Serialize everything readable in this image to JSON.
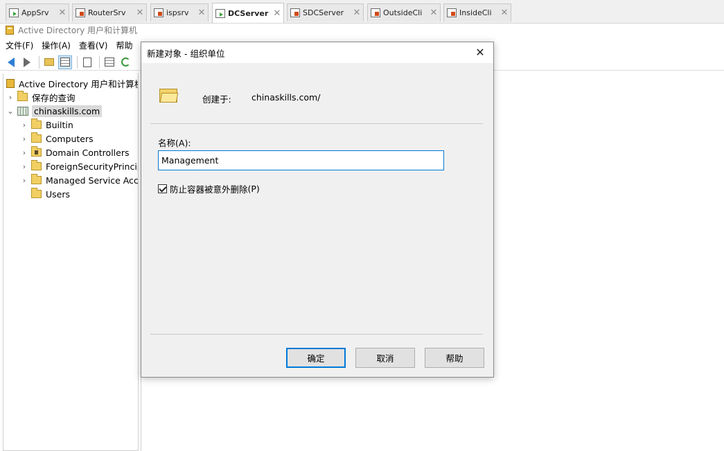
{
  "vm_tabs": [
    {
      "label": "AppSrv",
      "state": "running",
      "active": false
    },
    {
      "label": "RouterSrv",
      "state": "off",
      "active": false
    },
    {
      "label": "ispsrv",
      "state": "off",
      "active": false
    },
    {
      "label": "DCServer",
      "state": "running",
      "active": true
    },
    {
      "label": "SDCServer",
      "state": "off",
      "active": false
    },
    {
      "label": "OutsideCli",
      "state": "off",
      "active": false
    },
    {
      "label": "InsideCli",
      "state": "off",
      "active": false
    }
  ],
  "window": {
    "title": "Active Directory 用户和计算机"
  },
  "menu": {
    "file": "文件(F)",
    "action": "操作(A)",
    "view": "查看(V)",
    "help": "帮助"
  },
  "tree": {
    "root": "Active Directory 用户和计算机",
    "saved_queries": "保存的查询",
    "domain": "chinaskills.com",
    "children": [
      "Builtin",
      "Computers",
      "Domain Controllers",
      "ForeignSecurityPrincipa",
      "Managed Service Acco",
      "Users"
    ]
  },
  "dialog": {
    "title": "新建对象 - 组织单位",
    "created_in_label": "创建于:",
    "created_in_value": "chinaskills.com/",
    "name_label": "名称",
    "name_accel": "(A):",
    "name_value": "Management",
    "protect_label": "防止容器被意外删除",
    "protect_accel": "(P)",
    "protect_checked": true,
    "ok": "确定",
    "cancel": "取消",
    "help": "帮助"
  }
}
